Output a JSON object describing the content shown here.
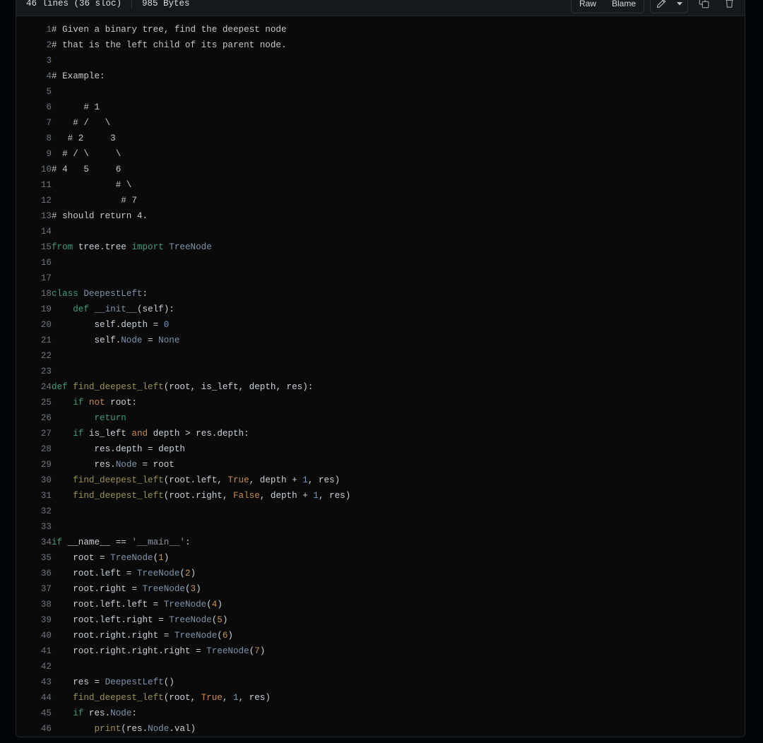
{
  "header": {
    "lines_label": "46 lines (36 sloc)",
    "size_label": "985 Bytes",
    "raw_label": "Raw",
    "blame_label": "Blame",
    "edit_icon": "pencil-icon",
    "caret_icon": "chevron-down-icon",
    "copy_icon": "copy-icon",
    "delete_icon": "trash-icon"
  },
  "code": {
    "language": "python",
    "lines": [
      {
        "n": "1",
        "tokens": [
          {
            "t": "# Given a binary tree, find the deepest node",
            "c": "tok-com"
          }
        ]
      },
      {
        "n": "2",
        "tokens": [
          {
            "t": "# that is the left child of its parent node.",
            "c": "tok-com"
          }
        ]
      },
      {
        "n": "3",
        "tokens": []
      },
      {
        "n": "4",
        "tokens": [
          {
            "t": "# Example:",
            "c": "tok-com"
          }
        ]
      },
      {
        "n": "5",
        "tokens": []
      },
      {
        "n": "6",
        "tokens": [
          {
            "t": "      # 1",
            "c": "tok-com"
          }
        ]
      },
      {
        "n": "7",
        "tokens": [
          {
            "t": "    # /   \\",
            "c": "tok-com"
          }
        ]
      },
      {
        "n": "8",
        "tokens": [
          {
            "t": "   # 2     3",
            "c": "tok-com"
          }
        ]
      },
      {
        "n": "9",
        "tokens": [
          {
            "t": "  # / \\     \\",
            "c": "tok-com"
          }
        ]
      },
      {
        "n": "10",
        "tokens": [
          {
            "t": "# 4   5     6",
            "c": "tok-com"
          }
        ]
      },
      {
        "n": "11",
        "tokens": [
          {
            "t": "            # \\",
            "c": "tok-com"
          }
        ]
      },
      {
        "n": "12",
        "tokens": [
          {
            "t": "             # 7",
            "c": "tok-com"
          }
        ]
      },
      {
        "n": "13",
        "tokens": [
          {
            "t": "# should return 4.",
            "c": "tok-com"
          }
        ]
      },
      {
        "n": "14",
        "tokens": []
      },
      {
        "n": "15",
        "tokens": [
          {
            "t": "from",
            "c": "tok-kw"
          },
          {
            "t": " tree.tree ",
            "c": "tok-pln"
          },
          {
            "t": "import",
            "c": "tok-kw"
          },
          {
            "t": " ",
            "c": "tok-pln"
          },
          {
            "t": "TreeNode",
            "c": "tok-cls"
          }
        ]
      },
      {
        "n": "16",
        "tokens": []
      },
      {
        "n": "17",
        "tokens": []
      },
      {
        "n": "18",
        "tokens": [
          {
            "t": "class",
            "c": "tok-kw"
          },
          {
            "t": " ",
            "c": "tok-pln"
          },
          {
            "t": "DeepestLeft",
            "c": "tok-cls"
          },
          {
            "t": ":",
            "c": "tok-pln"
          }
        ]
      },
      {
        "n": "19",
        "tokens": [
          {
            "t": "    ",
            "c": "tok-pln"
          },
          {
            "t": "def",
            "c": "tok-kw"
          },
          {
            "t": " ",
            "c": "tok-pln"
          },
          {
            "t": "__init__",
            "c": "tok-cls"
          },
          {
            "t": "(self):",
            "c": "tok-pln"
          }
        ]
      },
      {
        "n": "20",
        "tokens": [
          {
            "t": "        self.depth = ",
            "c": "tok-pln"
          },
          {
            "t": "0",
            "c": "tok-num"
          }
        ]
      },
      {
        "n": "21",
        "tokens": [
          {
            "t": "        self.",
            "c": "tok-pln"
          },
          {
            "t": "Node",
            "c": "tok-id"
          },
          {
            "t": " = ",
            "c": "tok-pln"
          },
          {
            "t": "None",
            "c": "tok-id"
          }
        ]
      },
      {
        "n": "22",
        "tokens": []
      },
      {
        "n": "23",
        "tokens": []
      },
      {
        "n": "24",
        "tokens": [
          {
            "t": "def",
            "c": "tok-kw"
          },
          {
            "t": " ",
            "c": "tok-pln"
          },
          {
            "t": "find_deepest_left",
            "c": "tok-fn"
          },
          {
            "t": "(root, is_left, depth, res):",
            "c": "tok-pln"
          }
        ]
      },
      {
        "n": "25",
        "tokens": [
          {
            "t": "    ",
            "c": "tok-pln"
          },
          {
            "t": "if",
            "c": "tok-kw"
          },
          {
            "t": " ",
            "c": "tok-pln"
          },
          {
            "t": "not",
            "c": "tok-kw2"
          },
          {
            "t": " root:",
            "c": "tok-pln"
          }
        ]
      },
      {
        "n": "26",
        "tokens": [
          {
            "t": "        ",
            "c": "tok-pln"
          },
          {
            "t": "return",
            "c": "tok-kw"
          }
        ]
      },
      {
        "n": "27",
        "tokens": [
          {
            "t": "    ",
            "c": "tok-pln"
          },
          {
            "t": "if",
            "c": "tok-kw"
          },
          {
            "t": " is_left ",
            "c": "tok-pln"
          },
          {
            "t": "and",
            "c": "tok-kw2"
          },
          {
            "t": " depth > res.depth:",
            "c": "tok-pln"
          }
        ]
      },
      {
        "n": "28",
        "tokens": [
          {
            "t": "        res.depth = depth",
            "c": "tok-pln"
          }
        ]
      },
      {
        "n": "29",
        "tokens": [
          {
            "t": "        res.",
            "c": "tok-pln"
          },
          {
            "t": "Node",
            "c": "tok-id"
          },
          {
            "t": " = root",
            "c": "tok-pln"
          }
        ]
      },
      {
        "n": "30",
        "tokens": [
          {
            "t": "    ",
            "c": "tok-pln"
          },
          {
            "t": "find_deepest_left",
            "c": "tok-fn"
          },
          {
            "t": "(root.left, ",
            "c": "tok-pln"
          },
          {
            "t": "True",
            "c": "tok-kw2"
          },
          {
            "t": ", depth + ",
            "c": "tok-pln"
          },
          {
            "t": "1",
            "c": "tok-num"
          },
          {
            "t": ", res)",
            "c": "tok-pln"
          }
        ]
      },
      {
        "n": "31",
        "tokens": [
          {
            "t": "    ",
            "c": "tok-pln"
          },
          {
            "t": "find_deepest_left",
            "c": "tok-fn"
          },
          {
            "t": "(root.right, ",
            "c": "tok-pln"
          },
          {
            "t": "False",
            "c": "tok-kw2"
          },
          {
            "t": ", depth + ",
            "c": "tok-pln"
          },
          {
            "t": "1",
            "c": "tok-num"
          },
          {
            "t": ", res)",
            "c": "tok-pln"
          }
        ]
      },
      {
        "n": "32",
        "tokens": []
      },
      {
        "n": "33",
        "tokens": []
      },
      {
        "n": "34",
        "tokens": [
          {
            "t": "if",
            "c": "tok-kw"
          },
          {
            "t": " __name__ == ",
            "c": "tok-pln"
          },
          {
            "t": "'__main__'",
            "c": "tok-str"
          },
          {
            "t": ":",
            "c": "tok-pln"
          }
        ]
      },
      {
        "n": "35",
        "tokens": [
          {
            "t": "    root = ",
            "c": "tok-pln"
          },
          {
            "t": "TreeNode",
            "c": "tok-cls"
          },
          {
            "t": "(",
            "c": "tok-pln"
          },
          {
            "t": "1",
            "c": "tok-num2"
          },
          {
            "t": ")",
            "c": "tok-pln"
          }
        ]
      },
      {
        "n": "36",
        "tokens": [
          {
            "t": "    root.left = ",
            "c": "tok-pln"
          },
          {
            "t": "TreeNode",
            "c": "tok-cls"
          },
          {
            "t": "(",
            "c": "tok-pln"
          },
          {
            "t": "2",
            "c": "tok-num2"
          },
          {
            "t": ")",
            "c": "tok-pln"
          }
        ]
      },
      {
        "n": "37",
        "tokens": [
          {
            "t": "    root.right = ",
            "c": "tok-pln"
          },
          {
            "t": "TreeNode",
            "c": "tok-cls"
          },
          {
            "t": "(",
            "c": "tok-pln"
          },
          {
            "t": "3",
            "c": "tok-num2"
          },
          {
            "t": ")",
            "c": "tok-pln"
          }
        ]
      },
      {
        "n": "38",
        "tokens": [
          {
            "t": "    root.left.left = ",
            "c": "tok-pln"
          },
          {
            "t": "TreeNode",
            "c": "tok-cls"
          },
          {
            "t": "(",
            "c": "tok-pln"
          },
          {
            "t": "4",
            "c": "tok-num2"
          },
          {
            "t": ")",
            "c": "tok-pln"
          }
        ]
      },
      {
        "n": "39",
        "tokens": [
          {
            "t": "    root.left.right = ",
            "c": "tok-pln"
          },
          {
            "t": "TreeNode",
            "c": "tok-cls"
          },
          {
            "t": "(",
            "c": "tok-pln"
          },
          {
            "t": "5",
            "c": "tok-num2"
          },
          {
            "t": ")",
            "c": "tok-pln"
          }
        ]
      },
      {
        "n": "40",
        "tokens": [
          {
            "t": "    root.right.right = ",
            "c": "tok-pln"
          },
          {
            "t": "TreeNode",
            "c": "tok-cls"
          },
          {
            "t": "(",
            "c": "tok-pln"
          },
          {
            "t": "6",
            "c": "tok-num2"
          },
          {
            "t": ")",
            "c": "tok-pln"
          }
        ]
      },
      {
        "n": "41",
        "tokens": [
          {
            "t": "    root.right.right.right = ",
            "c": "tok-pln"
          },
          {
            "t": "TreeNode",
            "c": "tok-cls"
          },
          {
            "t": "(",
            "c": "tok-pln"
          },
          {
            "t": "7",
            "c": "tok-num2"
          },
          {
            "t": ")",
            "c": "tok-pln"
          }
        ]
      },
      {
        "n": "42",
        "tokens": []
      },
      {
        "n": "43",
        "tokens": [
          {
            "t": "    res = ",
            "c": "tok-pln"
          },
          {
            "t": "DeepestLeft",
            "c": "tok-cls"
          },
          {
            "t": "()",
            "c": "tok-pln"
          }
        ]
      },
      {
        "n": "44",
        "tokens": [
          {
            "t": "    ",
            "c": "tok-pln"
          },
          {
            "t": "find_deepest_left",
            "c": "tok-fn"
          },
          {
            "t": "(root, ",
            "c": "tok-pln"
          },
          {
            "t": "True",
            "c": "tok-kw2"
          },
          {
            "t": ", ",
            "c": "tok-pln"
          },
          {
            "t": "1",
            "c": "tok-num"
          },
          {
            "t": ", res)",
            "c": "tok-pln"
          }
        ]
      },
      {
        "n": "45",
        "tokens": [
          {
            "t": "    ",
            "c": "tok-pln"
          },
          {
            "t": "if",
            "c": "tok-kw"
          },
          {
            "t": " res.",
            "c": "tok-pln"
          },
          {
            "t": "Node",
            "c": "tok-id"
          },
          {
            "t": ":",
            "c": "tok-pln"
          }
        ]
      },
      {
        "n": "46",
        "tokens": [
          {
            "t": "        ",
            "c": "tok-pln"
          },
          {
            "t": "print",
            "c": "tok-fn"
          },
          {
            "t": "(res.",
            "c": "tok-pln"
          },
          {
            "t": "Node",
            "c": "tok-id"
          },
          {
            "t": ".val)",
            "c": "tok-pln"
          }
        ]
      }
    ]
  },
  "colors": {
    "page_background": "#010409",
    "container_background": "#0a0a0a",
    "header_background": "#15181c",
    "border": "#22262c",
    "line_number": "#6e7681",
    "text": "#c9d1d9",
    "keyword": "#3f9c78",
    "keyword_alt": "#c98a4b",
    "function": "#9c9152",
    "class": "#7d94ad",
    "number": "#6f9bc4",
    "string": "#8a97a3",
    "comment": "#c9c9c4"
  }
}
